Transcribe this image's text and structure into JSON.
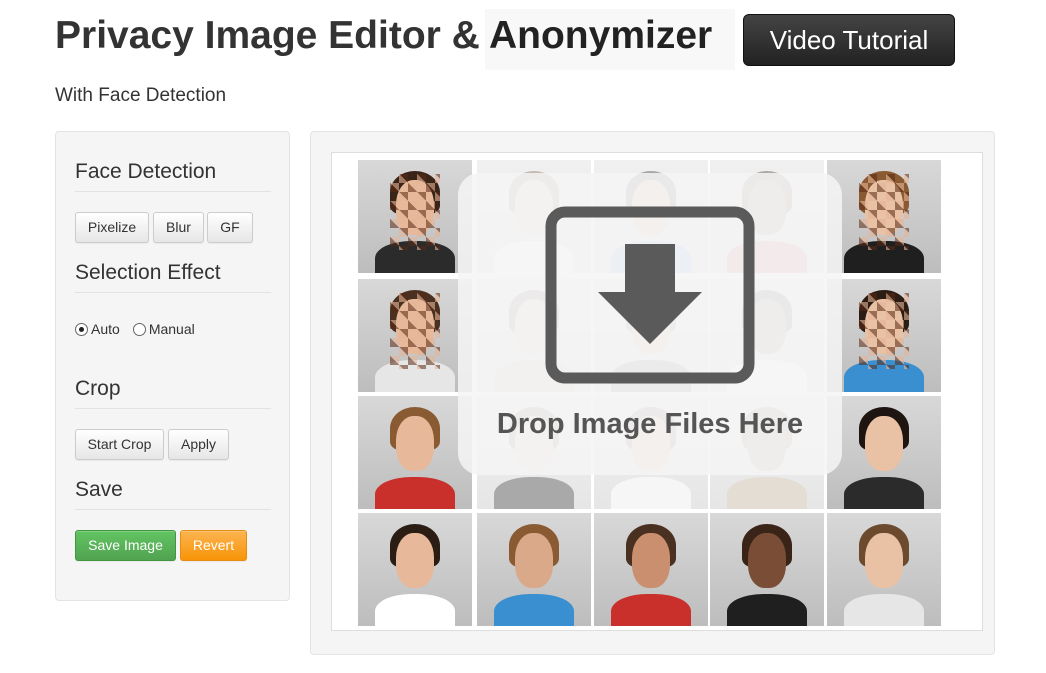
{
  "header": {
    "title_main": "Privacy Image Editor &",
    "title_highlight": "Anonymizer",
    "video_button": "Video Tutorial",
    "subtitle": "With Face Detection"
  },
  "sidebar": {
    "face_detection": {
      "title": "Face Detection",
      "buttons": [
        "Pixelize",
        "Blur",
        "GF"
      ]
    },
    "selection_effect": {
      "title": "Selection Effect",
      "options": [
        "Auto",
        "Manual"
      ],
      "selected": "Auto"
    },
    "crop": {
      "title": "Crop",
      "buttons": [
        "Start Crop",
        "Apply"
      ]
    },
    "save": {
      "title": "Save",
      "save_button": "Save Image",
      "revert_button": "Revert"
    }
  },
  "canvas": {
    "drop_text": "Drop Image Files Here",
    "drop_icon": "download-arrow-icon"
  },
  "colors": {
    "save_green": "#5bb75b",
    "revert_orange": "#faa732",
    "video_button_dark": "#333333"
  }
}
